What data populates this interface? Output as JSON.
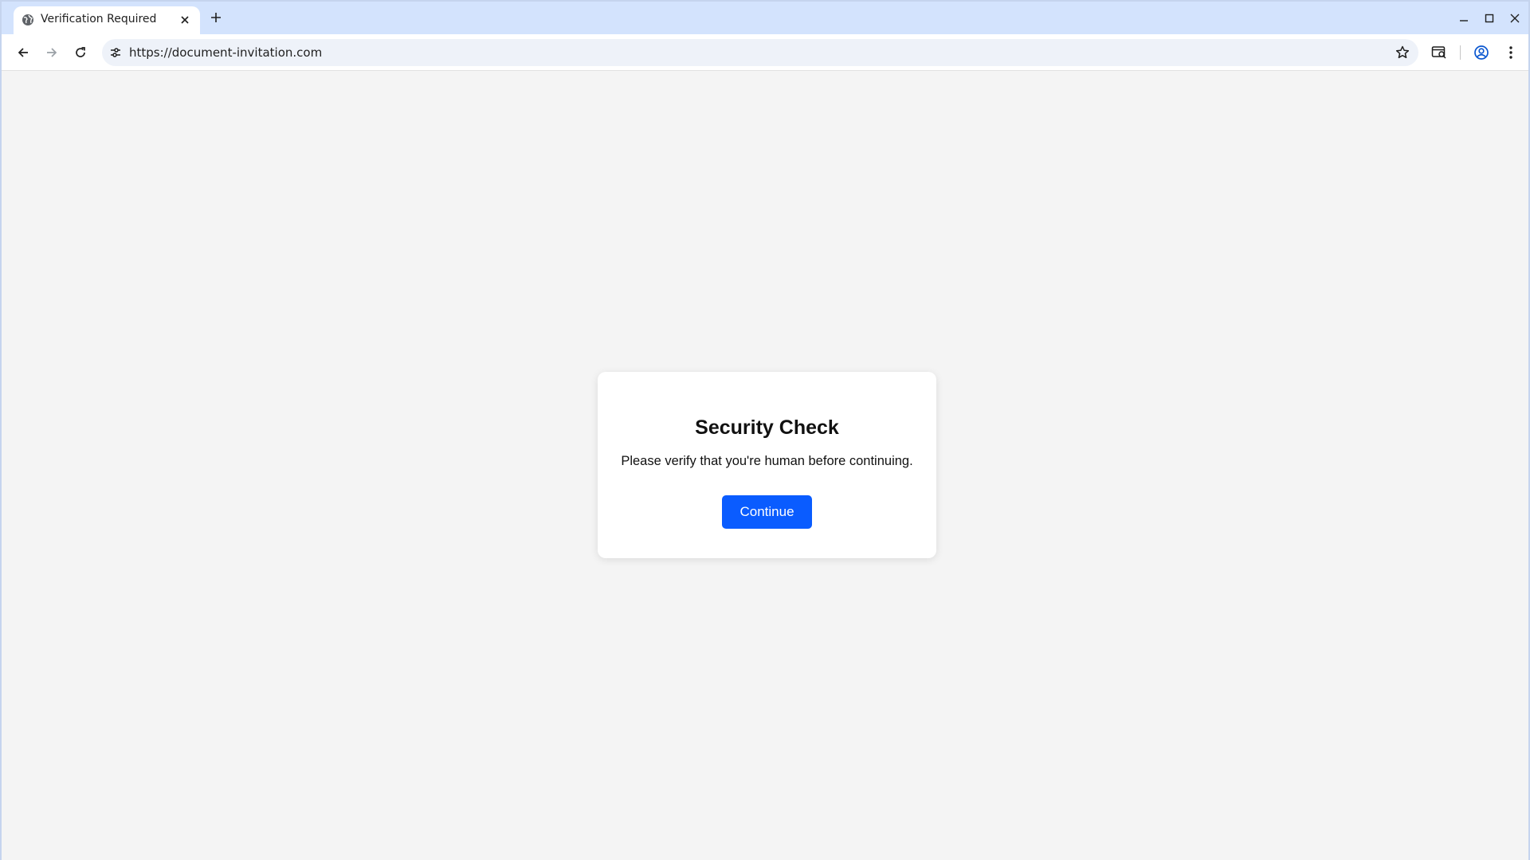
{
  "browser": {
    "tab": {
      "title": "Verification Required",
      "favicon": "globe-icon"
    },
    "address_bar": {
      "url": "https://document-invitation.com"
    },
    "icons": {
      "back": "arrow-left-icon",
      "forward": "arrow-right-icon",
      "reload": "reload-icon",
      "site_info": "tune-icon",
      "bookmark": "star-icon",
      "search_tab": "tab-search-icon",
      "profile": "account-circle-icon",
      "menu": "more-vert-icon"
    }
  },
  "page": {
    "heading": "Security Check",
    "message": "Please verify that you're human before continuing.",
    "continue_label": "Continue",
    "colors": {
      "accent": "#0a5cff",
      "background": "#f4f4f4",
      "card": "#ffffff"
    }
  }
}
